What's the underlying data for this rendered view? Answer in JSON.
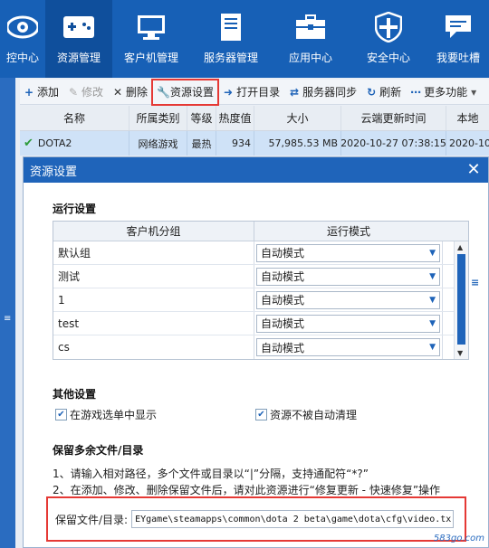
{
  "nav": {
    "items": [
      {
        "label": "控中心",
        "icon": "eye-icon"
      },
      {
        "label": "资源管理",
        "icon": "gamepad-icon",
        "active": true
      },
      {
        "label": "客户机管理",
        "icon": "monitor-icon"
      },
      {
        "label": "服务器管理",
        "icon": "server-icon"
      },
      {
        "label": "应用中心",
        "icon": "toolbox-icon"
      },
      {
        "label": "安全中心",
        "icon": "shield-icon"
      },
      {
        "label": "我要吐槽",
        "icon": "chat-icon"
      }
    ]
  },
  "toolbar": {
    "add": "添加",
    "modify": "修改",
    "delete": "删除",
    "resource_settings": "资源设置",
    "open_dir": "打开目录",
    "server_sync": "服务器同步",
    "refresh": "刷新",
    "more": "更多功能"
  },
  "game_table": {
    "headers": [
      "名称",
      "所属类别",
      "等级",
      "热度值",
      "大小",
      "云端更新时间",
      "本地"
    ],
    "row": {
      "name": "DOTA2",
      "category": "网络游戏",
      "level": "最热",
      "heat": "934",
      "size": "57,985.53 MB",
      "cloud_time": "2020-10-27 07:38:15",
      "local_time": "2020-10"
    }
  },
  "dialog": {
    "title": "资源设置",
    "run_settings_title": "运行设置",
    "run_table": {
      "headers": [
        "客户机分组",
        "运行模式"
      ],
      "rows": [
        {
          "group": "默认组",
          "mode": "自动模式"
        },
        {
          "group": "测试",
          "mode": "自动模式"
        },
        {
          "group": "1",
          "mode": "自动模式"
        },
        {
          "group": "test",
          "mode": "自动模式"
        },
        {
          "group": "cs",
          "mode": "自动模式"
        }
      ]
    },
    "other_settings_title": "其他设置",
    "show_in_menu": "在游戏选单中显示",
    "no_auto_clean": "资源不被自动清理",
    "keep_files_title": "保留多余文件/目录",
    "note1": "1、请输入相对路径，多个文件或目录以“|”分隔，支持通配符“*?”",
    "note2": "2、在添加、修改、删除保留文件后，请对此资源进行“修复更新 - 快速修复”操作",
    "keep_label": "保留文件/目录:",
    "keep_value": "EYgame\\steamapps\\common\\dota 2 beta\\game\\dota\\cfg\\video.tx"
  },
  "watermark": "583go.com"
}
